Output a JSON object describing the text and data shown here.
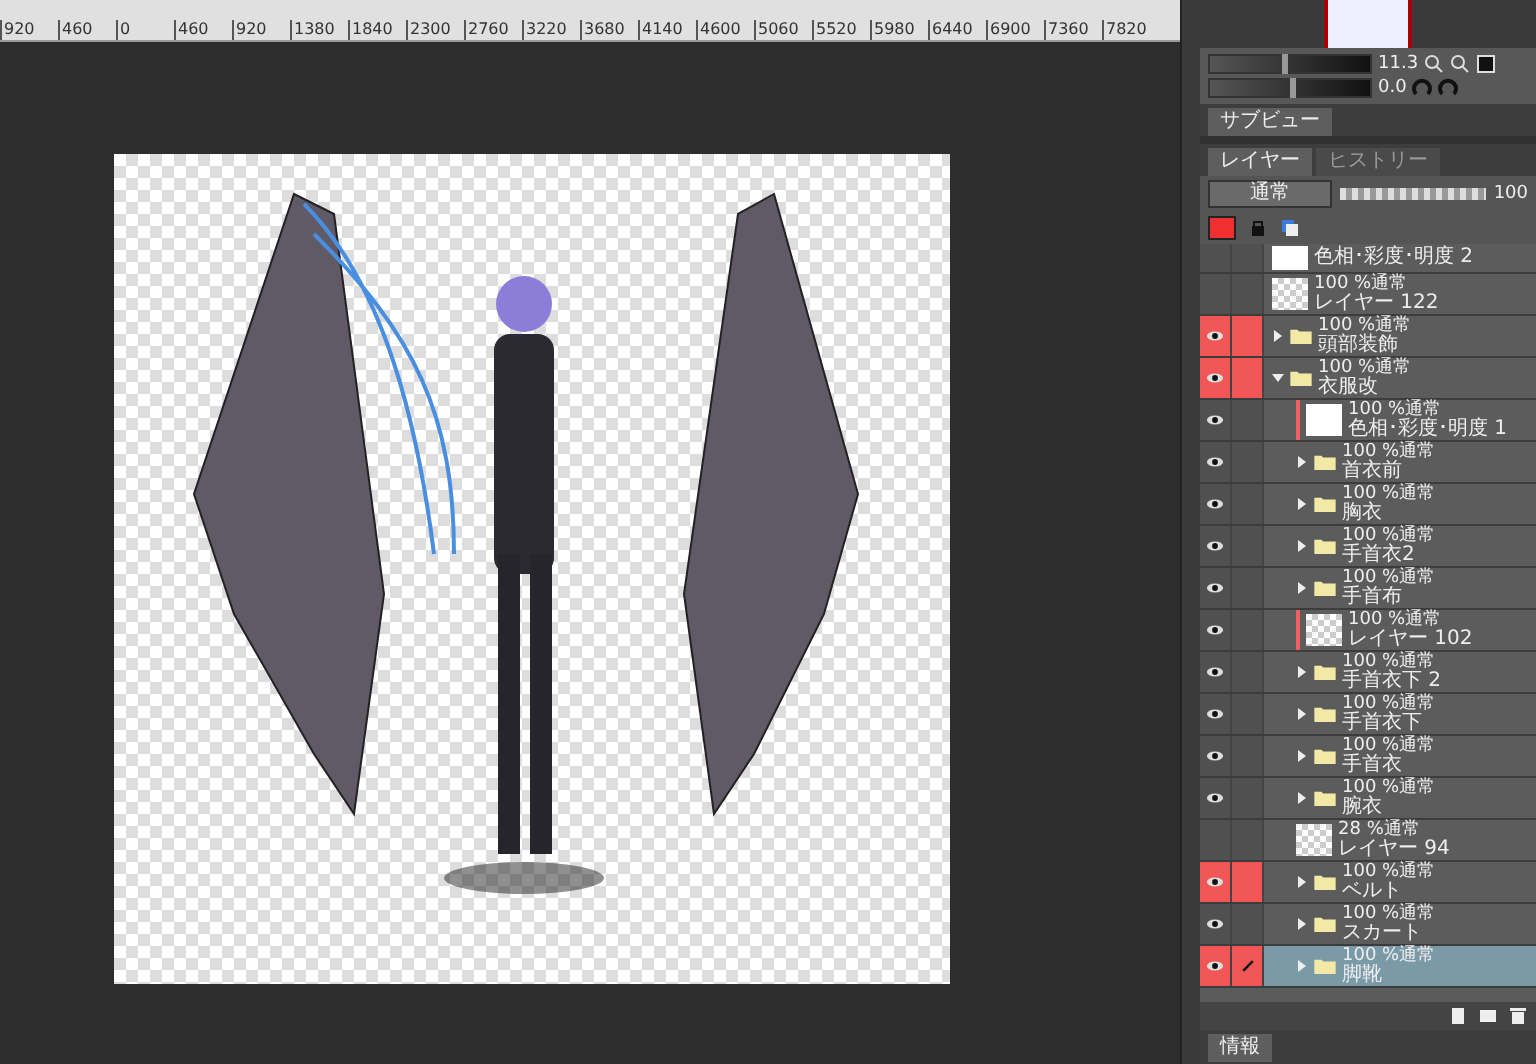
{
  "ruler": {
    "ticks": [
      "920",
      "460",
      "0",
      "460",
      "920",
      "1380",
      "1840",
      "2300",
      "2760",
      "3220",
      "3680",
      "4140",
      "4600",
      "5060",
      "5520",
      "5980",
      "6440",
      "6900",
      "7360",
      "7820"
    ]
  },
  "navigator": {
    "zoom": "11.3",
    "angle": "0.0",
    "zoom_slider": {
      "level": 0.45
    },
    "rotate_slider": {
      "level": 0.5
    }
  },
  "subview_tabs": [
    {
      "label": "サブビュー",
      "selected": true
    }
  ],
  "layer_panel": {
    "tabs": [
      {
        "label": "レイヤー",
        "selected": true
      },
      {
        "label": "ヒストリー",
        "selected": false
      }
    ],
    "blend_mode": "通常",
    "opacity": "100",
    "level": 1,
    "layers": [
      {
        "kind": "adjustment",
        "name": "色相･彩度･明度 2",
        "visible": false,
        "highlighted": false,
        "selected": false
      },
      {
        "kind": "raster",
        "mode": "100 %通常",
        "name": "レイヤー 122",
        "visible": false,
        "highlighted": false,
        "selected": false
      },
      {
        "kind": "folder",
        "mode": "100 %通常",
        "name": "頭部装飾",
        "visible": true,
        "highlighted": true,
        "selected": false,
        "expanded": false
      },
      {
        "kind": "folder",
        "mode": "100 %通常",
        "name": "衣服改",
        "visible": true,
        "highlighted": true,
        "selected": false,
        "expanded": true,
        "children": [
          {
            "kind": "adjustment",
            "mode": "100 %通常",
            "name": "色相･彩度･明度 1",
            "visible": true,
            "highlighted": false,
            "selected": false,
            "clipped": true
          },
          {
            "kind": "folder",
            "mode": "100 %通常",
            "name": "首衣前",
            "visible": true,
            "highlighted": false,
            "selected": false,
            "expanded": false
          },
          {
            "kind": "folder",
            "mode": "100 %通常",
            "name": "胸衣",
            "visible": true,
            "highlighted": false,
            "selected": false,
            "expanded": false
          },
          {
            "kind": "folder",
            "mode": "100 %通常",
            "name": "手首衣2",
            "visible": true,
            "highlighted": false,
            "selected": false,
            "expanded": false
          },
          {
            "kind": "folder",
            "mode": "100 %通常",
            "name": "手首布",
            "visible": true,
            "highlighted": false,
            "selected": false,
            "expanded": false
          },
          {
            "kind": "raster",
            "mode": "100 %通常",
            "name": "レイヤー 102",
            "visible": true,
            "highlighted": false,
            "selected": false,
            "clipped": true
          },
          {
            "kind": "folder",
            "mode": "100 %通常",
            "name": "手首衣下 2",
            "visible": true,
            "highlighted": false,
            "selected": false,
            "expanded": false
          },
          {
            "kind": "folder",
            "mode": "100 %通常",
            "name": "手首衣下",
            "visible": true,
            "highlighted": false,
            "selected": false,
            "expanded": false
          },
          {
            "kind": "folder",
            "mode": "100 %通常",
            "name": "手首衣",
            "visible": true,
            "highlighted": false,
            "selected": false,
            "expanded": false
          },
          {
            "kind": "folder",
            "mode": "100 %通常",
            "name": "腕衣",
            "visible": true,
            "highlighted": false,
            "selected": false,
            "expanded": false
          },
          {
            "kind": "raster",
            "mode": "28 %通常",
            "name": "レイヤー 94",
            "visible": false,
            "highlighted": false,
            "selected": false
          },
          {
            "kind": "folder",
            "mode": "100 %通常",
            "name": "ベルト",
            "visible": true,
            "highlighted": true,
            "selected": false,
            "expanded": false
          },
          {
            "kind": "folder",
            "mode": "100 %通常",
            "name": "スカート",
            "visible": true,
            "highlighted": false,
            "selected": false,
            "expanded": false
          },
          {
            "kind": "folder",
            "mode": "100 %通常",
            "name": "脚靴",
            "visible": true,
            "highlighted": true,
            "selected": true,
            "expanded": false,
            "editing": true
          }
        ]
      }
    ]
  },
  "bottom_tab": {
    "label": "情報"
  }
}
